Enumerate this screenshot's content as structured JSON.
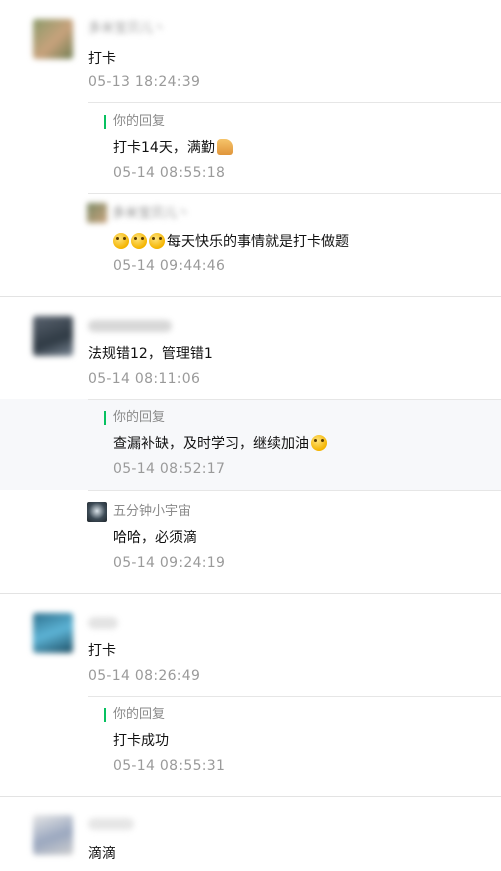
{
  "threads": [
    {
      "nickname": "多米宝贝儿丶",
      "comment": "打卡",
      "time": "05-13 18:24:39",
      "reply_label": "你的回复",
      "reply_text": "打卡14天，满勤",
      "reply_time": "05-14 08:55:18",
      "sub_nickname": "多米宝贝儿丶",
      "sub_text": "每天快乐的事情就是打卡做题",
      "sub_time": "05-14 09:44:46"
    },
    {
      "comment": "法规错12，管理错1",
      "time": "05-14 08:11:06",
      "reply_label": "你的回复",
      "reply_text": "查漏补缺，及时学习，继续加油",
      "reply_time": "05-14 08:52:17",
      "sub_nickname": "五分钟小宇宙",
      "sub_text": "哈哈，必须滴",
      "sub_time": "05-14 09:24:19"
    },
    {
      "comment": "打卡",
      "time": "05-14 08:26:49",
      "reply_label": "你的回复",
      "reply_text": "打卡成功",
      "reply_time": "05-14 08:55:31"
    },
    {
      "comment": "滴滴"
    }
  ],
  "icons": {
    "emoji": "smiling-face-icon",
    "thumb": "thumbs-up-icon"
  },
  "colors": {
    "accent_bar": "#07c160",
    "timestamp": "#9a9a9a",
    "highlight_bg": "#f7f8fa"
  }
}
